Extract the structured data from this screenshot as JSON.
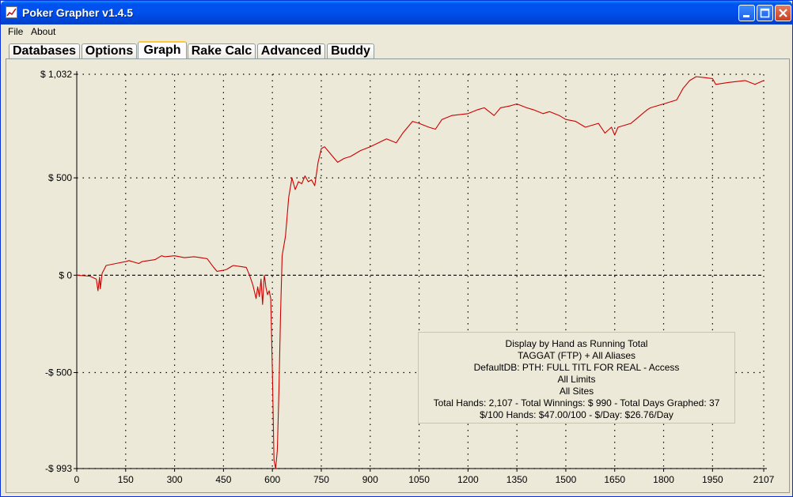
{
  "window": {
    "title": "Poker Grapher v1.4.5"
  },
  "menu": [
    {
      "label": "File"
    },
    {
      "label": "About"
    }
  ],
  "tabs": [
    {
      "label": "Databases",
      "active": false
    },
    {
      "label": "Options",
      "active": false
    },
    {
      "label": "Graph",
      "active": true
    },
    {
      "label": "Rake Calc",
      "active": false
    },
    {
      "label": "Advanced",
      "active": false
    },
    {
      "label": "Buddy",
      "active": false
    }
  ],
  "info": {
    "line1": "Display by Hand as Running Total",
    "line2": "TAGGAT (FTP) + All Aliases",
    "line3": "DefaultDB: PTH: FULL TITL FOR REAL - Access",
    "line4": "All Limits",
    "line5": "All Sites",
    "line6": "Total Hands: 2,107 - Total Winnings: $ 990 - Total Days Graphed: 37",
    "line7": "$/100 Hands: $47.00/100 - $/Day: $26.76/Day"
  },
  "chart_data": {
    "type": "line",
    "title": "",
    "xlabel": "",
    "ylabel": "",
    "xlim": [
      0,
      2107
    ],
    "ylim": [
      -993,
      1032
    ],
    "x_ticks": [
      0,
      150,
      300,
      450,
      600,
      750,
      900,
      1050,
      1200,
      1350,
      1500,
      1650,
      1800,
      1950,
      2107
    ],
    "y_ticks": [
      {
        "value": 1032,
        "label": "$ 1,032"
      },
      {
        "value": 500,
        "label": "$ 500"
      },
      {
        "value": 0,
        "label": "$ 0"
      },
      {
        "value": -500,
        "label": "-$ 500"
      },
      {
        "value": -993,
        "label": "-$ 993"
      }
    ],
    "grid": true,
    "line_color": "#cc0000",
    "series": [
      {
        "x": [
          0,
          40,
          60,
          65,
          70,
          72,
          78,
          90,
          120,
          150,
          160,
          190,
          200,
          240,
          260,
          270,
          300,
          330,
          360,
          380,
          400,
          420,
          430,
          450,
          460,
          470,
          480,
          500,
          520,
          530,
          540,
          550,
          555,
          560,
          565,
          570,
          575,
          578,
          580,
          585,
          590,
          595,
          600,
          605,
          610,
          615,
          620,
          625,
          630,
          640,
          650,
          660,
          670,
          680,
          690,
          700,
          710,
          720,
          730,
          740,
          750,
          760,
          770,
          800,
          820,
          840,
          870,
          900,
          950,
          980,
          1000,
          1030,
          1050,
          1080,
          1100,
          1120,
          1150,
          1200,
          1230,
          1250,
          1280,
          1300,
          1330,
          1350,
          1380,
          1400,
          1430,
          1450,
          1480,
          1500,
          1530,
          1560,
          1600,
          1620,
          1640,
          1650,
          1660,
          1700,
          1750,
          1760,
          1800,
          1840,
          1850,
          1860,
          1880,
          1900,
          1950,
          1960,
          2000,
          2050,
          2080,
          2107
        ],
        "y": [
          0,
          -5,
          -20,
          -80,
          -10,
          -70,
          10,
          50,
          60,
          70,
          75,
          60,
          70,
          80,
          100,
          95,
          100,
          90,
          95,
          90,
          85,
          40,
          20,
          25,
          30,
          40,
          50,
          45,
          40,
          0,
          -50,
          -120,
          -60,
          -110,
          -20,
          -150,
          0,
          -30,
          -60,
          -100,
          -80,
          -120,
          -500,
          -950,
          -993,
          -900,
          -600,
          -200,
          100,
          200,
          400,
          500,
          440,
          480,
          470,
          510,
          480,
          490,
          460,
          580,
          650,
          660,
          640,
          580,
          600,
          610,
          640,
          660,
          700,
          680,
          730,
          790,
          780,
          760,
          750,
          800,
          820,
          830,
          850,
          860,
          820,
          860,
          870,
          880,
          860,
          850,
          830,
          840,
          820,
          800,
          790,
          760,
          780,
          730,
          760,
          720,
          760,
          780,
          850,
          860,
          880,
          900,
          930,
          960,
          1000,
          1020,
          1010,
          980,
          990,
          1000,
          980,
          1000
        ]
      }
    ]
  }
}
